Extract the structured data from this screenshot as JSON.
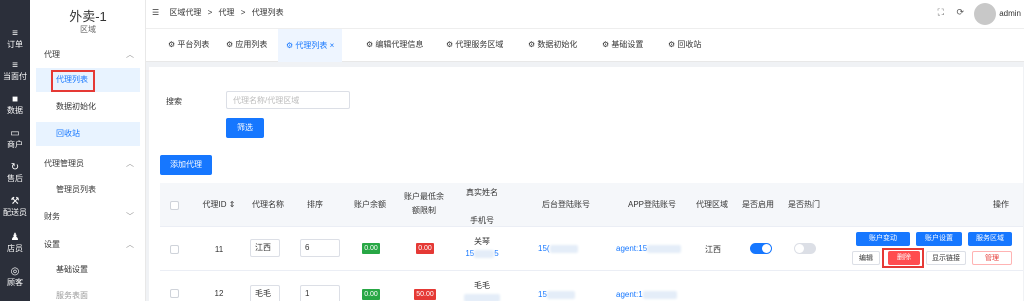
{
  "rail": {
    "items": [
      {
        "icon": "≡",
        "label": "订单"
      },
      {
        "icon": "≡",
        "label": "当面付"
      },
      {
        "icon": "■",
        "label": "数据"
      },
      {
        "icon": "▭",
        "label": "商户"
      },
      {
        "icon": "↻",
        "label": "售后"
      },
      {
        "icon": "⚒",
        "label": "配送员"
      },
      {
        "icon": "♟",
        "label": "店员"
      },
      {
        "icon": "◎",
        "label": "顾客"
      }
    ]
  },
  "sidebar": {
    "title": "外卖-1",
    "subtitle": "区域",
    "groups": [
      {
        "label": "代理",
        "chevron": "︿"
      },
      {
        "label": "代理管理员",
        "chevron": "︿"
      },
      {
        "label": "财务",
        "chevron": "﹀"
      },
      {
        "label": "设置",
        "chevron": "︿"
      }
    ],
    "items": [
      "代理列表",
      "数据初始化",
      "回收站",
      "管理员列表",
      "基础设置",
      "服务表面"
    ]
  },
  "header": {
    "menu_icon": "☰",
    "breadcrumb": [
      "区域代理",
      ">",
      "代理",
      ">",
      "代理列表"
    ],
    "user": "admin",
    "fullscreen_icon": "⛶",
    "refresh_icon": "⟳"
  },
  "tabs": [
    {
      "label": "平台列表"
    },
    {
      "label": "应用列表"
    },
    {
      "label": "代理列表",
      "close": "×"
    },
    {
      "label": "编辑代理信息"
    },
    {
      "label": "代理服务区域"
    },
    {
      "label": "数据初始化"
    },
    {
      "label": "基础设置"
    },
    {
      "label": "回收站"
    }
  ],
  "search": {
    "label": "搜索",
    "placeholder": "代理名称/代理区域",
    "button": "筛选"
  },
  "add_button": "添加代理",
  "table": {
    "columns": {
      "id": "代理ID",
      "name": "代理名称",
      "sort": "排序",
      "balance": "账户余额",
      "min_limit_1": "账户最低余",
      "min_limit_2": "额限制",
      "realname_1": "真实姓名",
      "realname_2": "手机号",
      "backend_account": "后台登陆账号",
      "app_account": "APP登陆账号",
      "region": "代理区域",
      "enabled": "是否启用",
      "hot": "是否热门",
      "actions": "操作"
    },
    "rows": [
      {
        "id": "11",
        "name": "江西",
        "sort": "6",
        "balance": "0.00",
        "min_limit": "0.00",
        "realname": "关琴",
        "phone_a": "15",
        "phone_b": "5",
        "backend_account": "15(",
        "app_account": "agent:15",
        "region": "江西",
        "enabled": true,
        "hot": false,
        "actions": [
          "账户变动",
          "账户设置",
          "服务区域",
          "编辑",
          "删除",
          "显示链接",
          "管理"
        ]
      },
      {
        "id": "12",
        "name": "毛毛",
        "sort": "1",
        "balance": "0.00",
        "min_limit": "50.00",
        "realname": "毛毛",
        "backend_account": "15",
        "app_account": "agent:1"
      }
    ]
  },
  "colors": {
    "primary": "#1677ff",
    "rail": "#2b2f3a",
    "green_tag": "#28a745",
    "red_tag": "#e53935"
  }
}
